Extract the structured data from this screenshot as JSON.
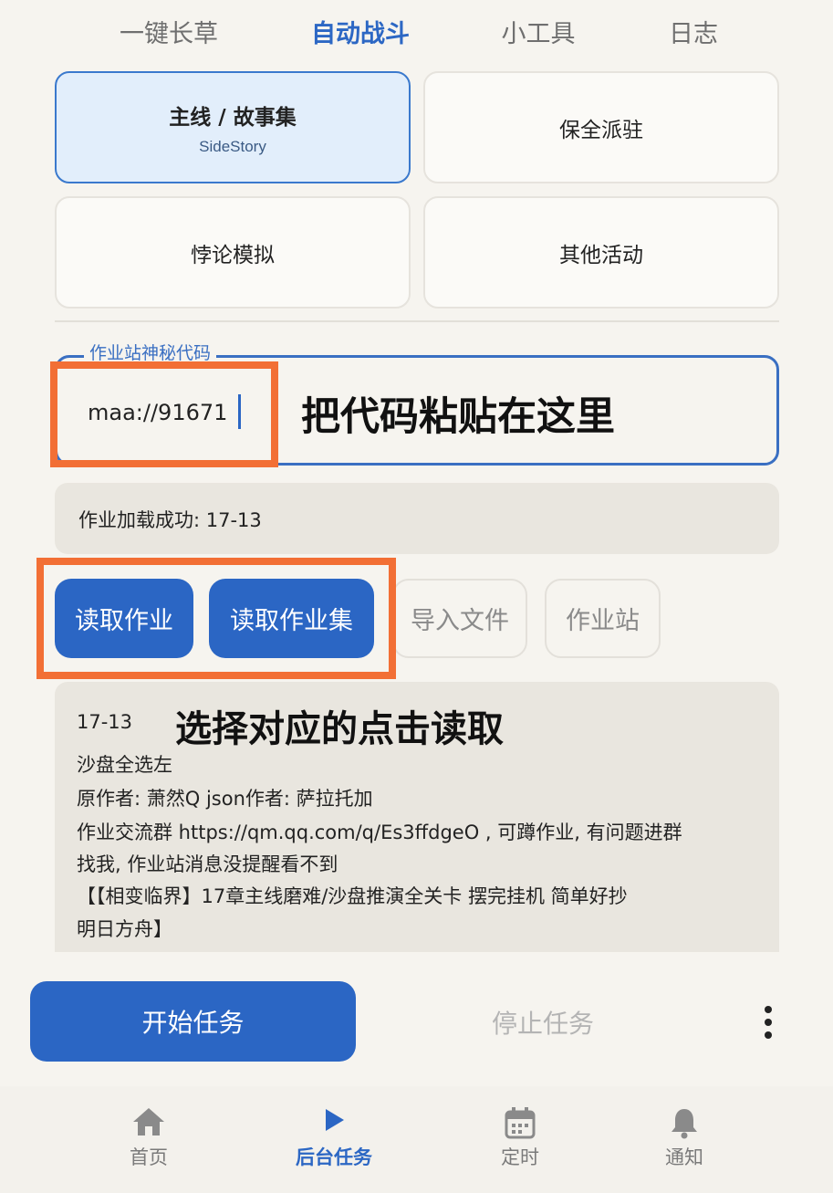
{
  "top_tabs": [
    {
      "label": "一键长草",
      "active": false
    },
    {
      "label": "自动战斗",
      "active": true
    },
    {
      "label": "小工具",
      "active": false
    },
    {
      "label": "日志",
      "active": false
    }
  ],
  "modes": [
    {
      "title": "主线 / 故事集",
      "subtitle": "SideStory",
      "selected": true
    },
    {
      "title": "保全派驻",
      "selected": false
    },
    {
      "title": "悖论模拟",
      "selected": false
    },
    {
      "title": "其他活动",
      "selected": false
    }
  ],
  "code_field": {
    "legend": "作业站神秘代码",
    "value": "maa://91671"
  },
  "annotations": {
    "paste_hint": "把代码粘贴在这里",
    "read_hint": "选择对应的点击读取"
  },
  "status": {
    "text": "作业加载成功: 17-13"
  },
  "actions": {
    "read_job": "读取作业",
    "read_job_set": "读取作业集",
    "import_file": "导入文件",
    "job_station": "作业站"
  },
  "details": {
    "stage": "17-13",
    "lines": [
      "沙盘全选左",
      "原作者: 萧然Q json作者: 萨拉托加",
      "作业交流群 https://qm.qq.com/q/Es3ffdgeO , 可蹲作业, 有问题进群",
      "找我, 作业站消息没提醒看不到",
      "【【相变临界】17章主线磨难/沙盘推演全关卡 摆完挂机 简单好抄",
      "明日方舟】"
    ]
  },
  "bottom_actions": {
    "start": "开始任务",
    "stop": "停止任务"
  },
  "nav": [
    {
      "label": "首页",
      "icon": "home-icon",
      "active": false
    },
    {
      "label": "后台任务",
      "icon": "play-icon",
      "active": true
    },
    {
      "label": "定时",
      "icon": "calendar-icon",
      "active": false
    },
    {
      "label": "通知",
      "icon": "bell-icon",
      "active": false
    }
  ],
  "colors": {
    "accent": "#2b66c4",
    "annotation_orange": "#f26f35",
    "background": "#f6f4ef"
  }
}
